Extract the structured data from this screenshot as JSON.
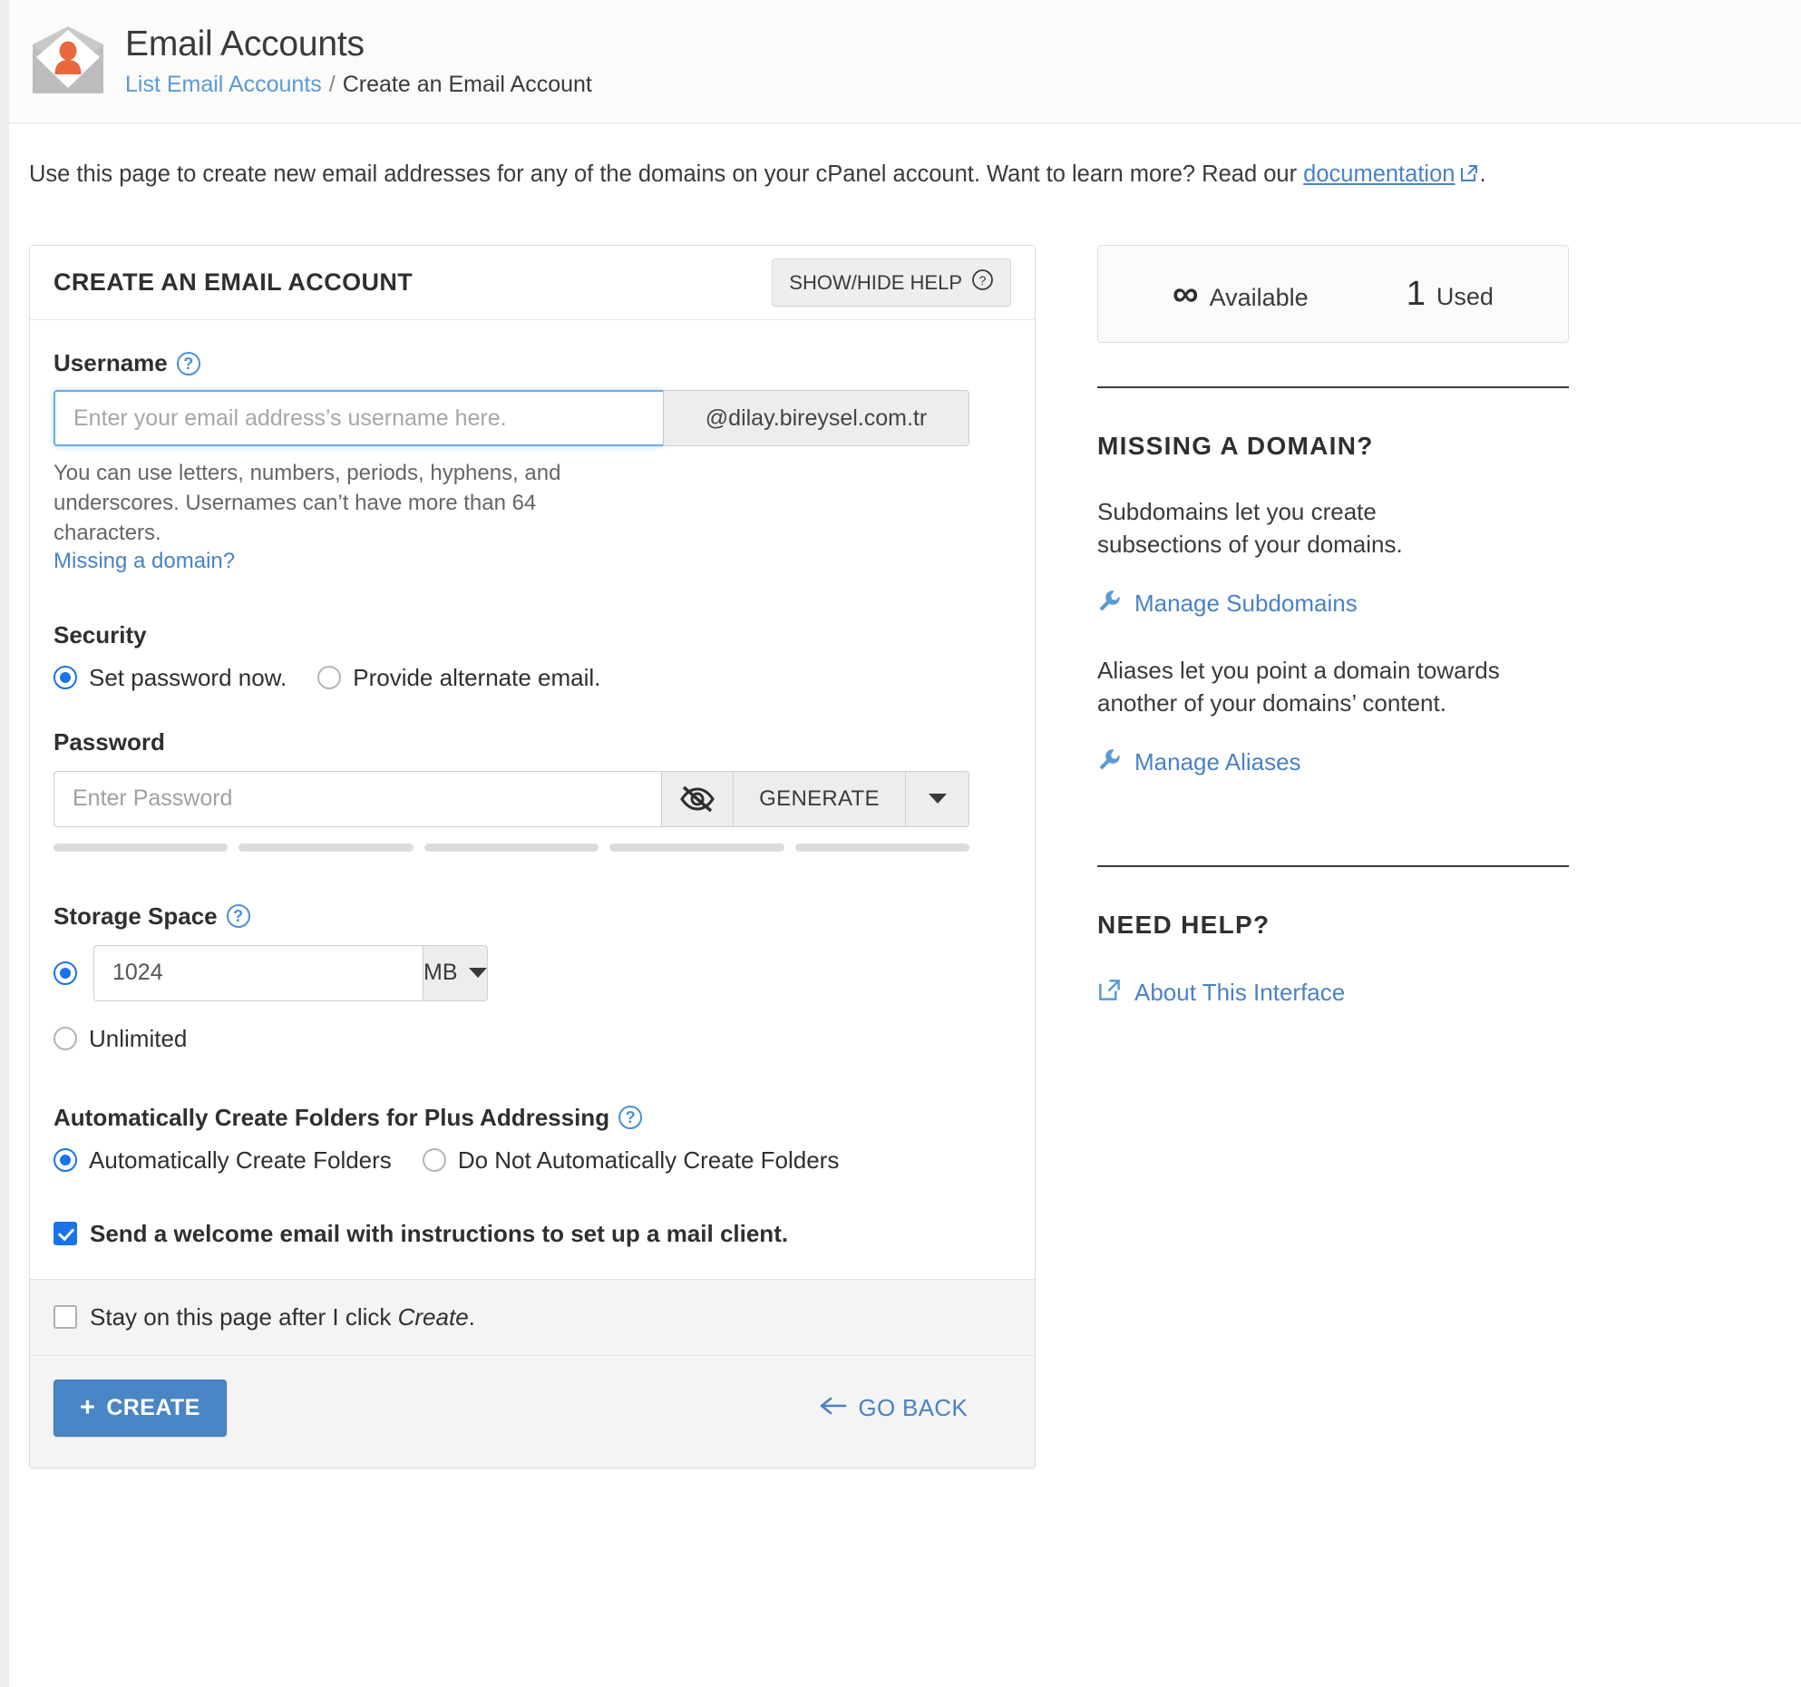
{
  "header": {
    "icon": "email-account-icon",
    "title": "Email Accounts",
    "breadcrumb_link": "List Email Accounts",
    "breadcrumb_sep": "/",
    "breadcrumb_current": "Create an Email Account"
  },
  "intro": {
    "text_before": "Use this page to create new email addresses for any of the domains on your cPanel account. Want to learn more? Read our ",
    "link": "documentation",
    "text_after": "."
  },
  "card": {
    "title": "CREATE AN EMAIL ACCOUNT",
    "help_toggle": "SHOW/HIDE HELP",
    "username": {
      "label": "Username",
      "placeholder": "Enter your email address’s username here.",
      "value": "",
      "domain": "@dilay.bireysel.com.tr",
      "hint": "You can use letters, numbers, periods, hyphens, and underscores. Usernames can’t have more than 64 characters.",
      "missing_domain_link": "Missing a domain?"
    },
    "security": {
      "label": "Security",
      "options": [
        {
          "label": "Set password now.",
          "checked": true
        },
        {
          "label": "Provide alternate email.",
          "checked": false
        }
      ]
    },
    "password": {
      "label": "Password",
      "placeholder": "Enter Password",
      "value": "",
      "eye_icon": "eye-slash-icon",
      "generate_label": "GENERATE",
      "caret_icon": "caret-down-icon",
      "strength_segments": 5,
      "strength_filled": 0
    },
    "storage": {
      "label": "Storage Space",
      "value": "1024",
      "unit": "MB",
      "quota_checked": true,
      "unlimited_label": "Unlimited",
      "unlimited_checked": false
    },
    "plus_addressing": {
      "label": "Automatically Create Folders for Plus Addressing",
      "options": [
        {
          "label": "Automatically Create Folders",
          "checked": true
        },
        {
          "label": "Do Not Automatically Create Folders",
          "checked": false
        }
      ]
    },
    "welcome_email": {
      "label": "Send a welcome email with instructions to set up a mail client.",
      "checked": true
    },
    "stay_on_page": {
      "text_before": "Stay on this page after I click ",
      "emphasis": "Create",
      "text_after": ".",
      "checked": false
    },
    "create_button": "CREATE",
    "go_back_button": "GO BACK"
  },
  "sidebar": {
    "stats": {
      "available_value": "∞",
      "available_label": "Available",
      "used_value": "1",
      "used_label": "Used"
    },
    "missing_domain": {
      "heading": "MISSING A DOMAIN?",
      "para_1": "Subdomains let you create subsections of your domains.",
      "link_1": "Manage Subdomains",
      "para_2": "Aliases let you point a domain towards another of your domains’ content.",
      "link_2": "Manage Aliases"
    },
    "need_help": {
      "heading": "NEED HELP?",
      "link": "About This Interface"
    }
  },
  "colors": {
    "accent_blue": "#4a82c4",
    "primary_button": "#4a86c5",
    "radio_blue": "#1a73e8",
    "icon_orange": "#e8693c"
  }
}
